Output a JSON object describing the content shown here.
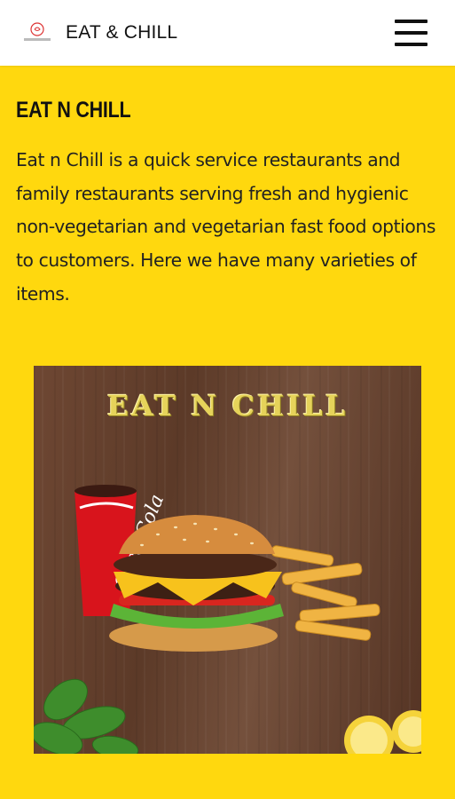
{
  "header": {
    "app_title": "EAT & CHILL",
    "logo_icon": "restaurant-logo-icon",
    "menu_icon": "hamburger-menu-icon"
  },
  "main": {
    "heading": "EAT N CHILL",
    "description": "Eat n Chill is a quick service restaurants and family restaurants serving fresh and hygienic non-vegetarian and vegetarian fast food options to customers. Here we have many varieties of items."
  },
  "promo": {
    "title": "EAT N CHILL",
    "cup_text": "Coca-Cola"
  },
  "colors": {
    "background": "#FFD80E",
    "header_bg": "#FFFFFF",
    "text": "#111111",
    "promo_title": "#E6D35A"
  }
}
